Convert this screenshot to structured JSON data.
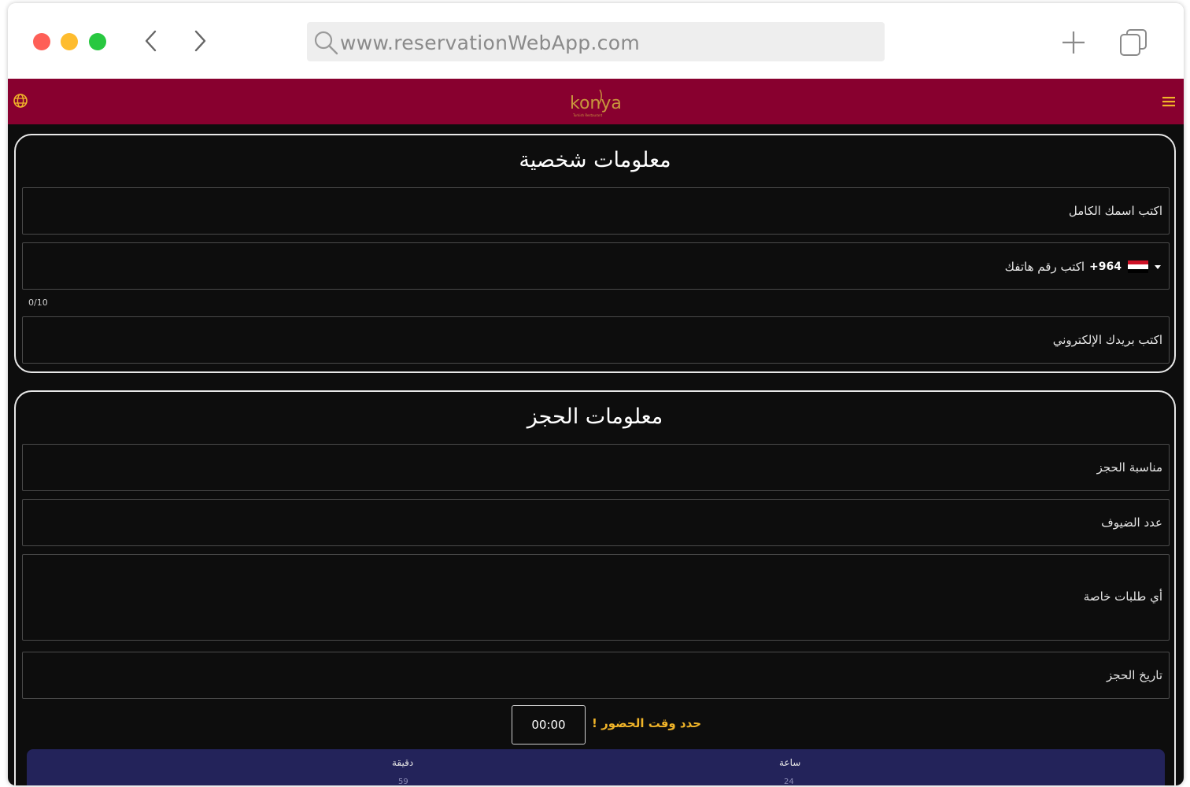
{
  "browser": {
    "url": "www.reservationWebApp.com"
  },
  "app": {
    "brand_color": "#88002f",
    "logo_text": "konya",
    "logo_subtext": "Turkish Restaurant"
  },
  "personal_info": {
    "title": "معلومات شخصية",
    "full_name_placeholder": "اكتب اسمك الكامل",
    "phone": {
      "country_code": "+964",
      "placeholder": "اكتب رقم هاتفك",
      "counter": "0/10"
    },
    "email_placeholder": "اكتب بريدك الإلكتروني"
  },
  "booking_info": {
    "title": "معلومات الحجز",
    "occasion_placeholder": "مناسبة الحجز",
    "guests_placeholder": "عدد الضيوف",
    "special_requests_placeholder": "أي طلبات خاصة",
    "date_placeholder": "تاريخ الحجز",
    "arrival_time_label": "حدد وقت الحضور !",
    "arrival_time_value": "00:00",
    "accent_color": "#f0b429"
  },
  "time_picker": {
    "hour_label": "ساعة",
    "minute_label": "دقيقة",
    "hour_value": "24",
    "minute_value": "59"
  }
}
